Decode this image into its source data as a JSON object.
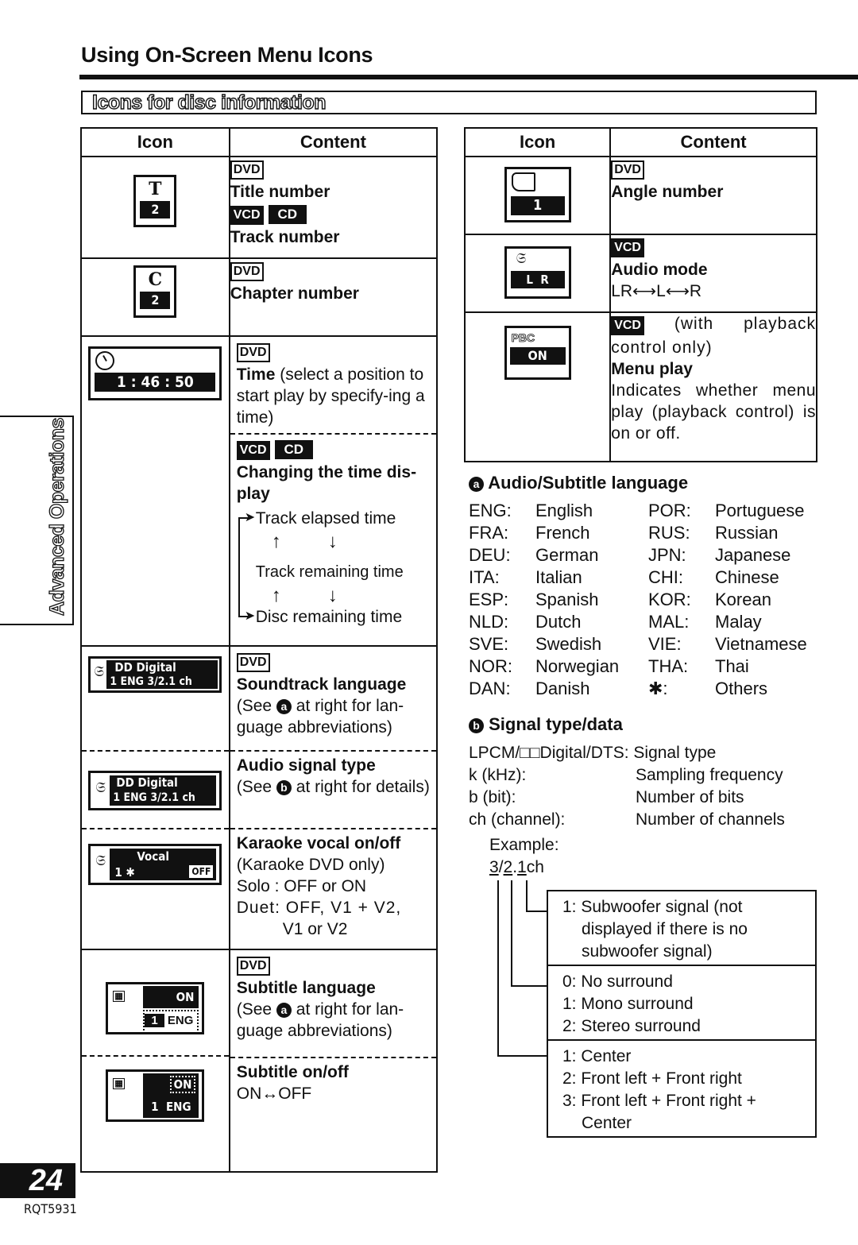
{
  "page_title": "Using On-Screen Menu Icons",
  "section_title": "Icons for disc information",
  "side_tab": "Advanced Operations",
  "page_number": "24",
  "doc_code": "RQT5931",
  "table_headers": {
    "icon": "Icon",
    "content": "Content"
  },
  "tags": {
    "dvd": "DVD",
    "vcd": "VCD",
    "cd": "CD"
  },
  "left_rows": [
    {
      "icon_main": "2",
      "icon_symbol": "T",
      "title": "Title number",
      "title2": "Track number"
    },
    {
      "icon_main": "2",
      "icon_symbol": "C",
      "title": "Chapter number"
    },
    {
      "icon_main": "1 : 46 : 50",
      "title": "Time",
      "desc": " (select a position to start play by specify-ing a time)",
      "title2": "Changing the time dis-play",
      "cycle": [
        "Track elapsed time",
        "Track remaining time",
        "Disc remaining time"
      ]
    },
    {
      "icon_line1": "DD Digital",
      "icon_line2a": "1 ENG",
      "icon_line2b": "3/2.1 ch",
      "title": "Soundtrack language",
      "desc_pre": "(See ",
      "desc_circ": "a",
      "desc_post": " at right for lan-guage abbreviations)"
    },
    {
      "icon_line1": "DD Digital",
      "icon_line2a": "1 ENG",
      "icon_line2b": "3/2.1 ch",
      "title": "Audio signal type",
      "desc_pre": "(See ",
      "desc_circ": "b",
      "desc_post": " at right for details)"
    },
    {
      "icon_line1": "Vocal",
      "icon_line2a": "1 ✱",
      "icon_line2b": "OFF",
      "title": "Karaoke vocal on/off",
      "lines": [
        "(Karaoke DVD only)",
        "Solo : OFF or ON",
        "Duet: OFF, V1 + V2,",
        "V1 or V2"
      ]
    },
    {
      "icon_line1": "ON",
      "icon_line2a": "1",
      "icon_line2b": "ENG",
      "title": "Subtitle language",
      "desc_pre": "(See ",
      "desc_circ": "a",
      "desc_post": " at right for lan-guage abbreviations)"
    },
    {
      "icon_line1": "ON",
      "icon_line2a": "1",
      "icon_line2b": "ENG",
      "title": "Subtitle on/off",
      "desc": "ON↔OFF"
    }
  ],
  "right_rows": [
    {
      "icon_main": "1",
      "title": "Angle number"
    },
    {
      "icon_main": "L  R",
      "title": "Audio mode",
      "desc": "LR⟷L⟷R"
    },
    {
      "icon_top": "PBC",
      "icon_main": "ON",
      "tag_note": " (with playback control only)",
      "title": "Menu play",
      "desc": "Indicates whether menu play (playback control) is on or off."
    }
  ],
  "languages": {
    "marker": "a",
    "heading": "Audio/Subtitle language",
    "items": [
      {
        "code": "ENG:",
        "name": "English"
      },
      {
        "code": "POR:",
        "name": "Portuguese"
      },
      {
        "code": "FRA:",
        "name": "French"
      },
      {
        "code": "RUS:",
        "name": "Russian"
      },
      {
        "code": "DEU:",
        "name": "German"
      },
      {
        "code": "JPN:",
        "name": "Japanese"
      },
      {
        "code": "ITA:",
        "name": "Italian"
      },
      {
        "code": "CHI:",
        "name": "Chinese"
      },
      {
        "code": "ESP:",
        "name": "Spanish"
      },
      {
        "code": "KOR:",
        "name": "Korean"
      },
      {
        "code": "NLD:",
        "name": "Dutch"
      },
      {
        "code": "MAL:",
        "name": "Malay"
      },
      {
        "code": "SVE:",
        "name": "Swedish"
      },
      {
        "code": "VIE:",
        "name": "Vietnamese"
      },
      {
        "code": "NOR:",
        "name": "Norwegian"
      },
      {
        "code": "THA:",
        "name": "Thai"
      },
      {
        "code": "DAN:",
        "name": "Danish"
      },
      {
        "code": "✱:",
        "name": "Others"
      }
    ]
  },
  "signal": {
    "marker": "b",
    "heading": "Signal type/data",
    "line1": "LPCM/□□Digital/DTS: Signal type",
    "pairs": [
      {
        "k": "k (kHz):",
        "v": "Sampling frequency"
      },
      {
        "k": "b (bit):",
        "v": "Number of bits"
      },
      {
        "k": "ch (channel):",
        "v": "Number of channels"
      }
    ],
    "example_label": "Example:",
    "example_parts": [
      "3",
      "/",
      "2",
      ".",
      "1",
      "ch"
    ],
    "breakdown": [
      [
        "1: Subwoofer signal (not displayed if there is no subwoofer signal)"
      ],
      [
        "0: No surround",
        "1: Mono surround",
        "2: Stereo surround"
      ],
      [
        "1: Center",
        "2: Front left + Front right",
        "3: Front left + Front right + Center"
      ]
    ]
  }
}
